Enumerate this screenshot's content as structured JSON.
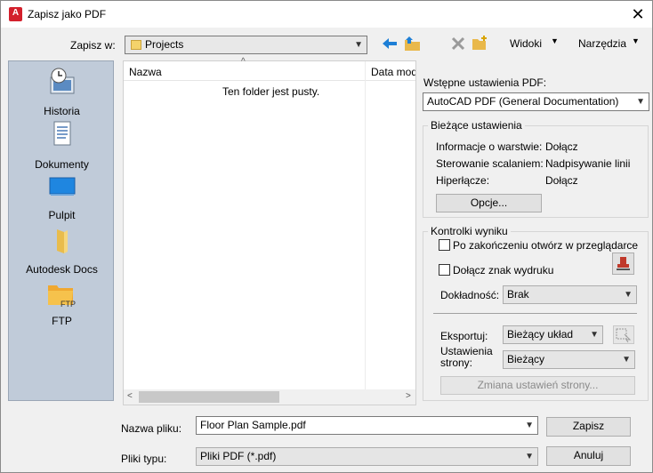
{
  "window": {
    "title": "Zapisz jako PDF",
    "app_icon": "A"
  },
  "toolbar": {
    "save_in_label": "Zapisz w:",
    "save_in_value": "Projects",
    "views_label": "Widoki",
    "tools_label": "Narzędzia"
  },
  "places": [
    {
      "label": "Historia",
      "icon": "history-icon"
    },
    {
      "label": "Dokumenty",
      "icon": "documents-icon"
    },
    {
      "label": "Pulpit",
      "icon": "desktop-icon"
    },
    {
      "label": "Autodesk Docs",
      "icon": "folder-icon"
    },
    {
      "label": "FTP",
      "icon": "ftp-folder-icon"
    }
  ],
  "filelist": {
    "col_name": "Nazwa",
    "col_date": "Data mod",
    "empty_text": "Ten folder jest pusty."
  },
  "pdf": {
    "presets_label": "Wstępne ustawienia PDF:",
    "preset_value": "AutoCAD PDF (General Documentation)",
    "current_title": "Bieżące ustawienia",
    "layers_label": "Informacje o warstwie:",
    "layers_value": "Dołącz",
    "merge_label": "Sterowanie scalaniem:",
    "merge_value": "Nadpisywanie linii",
    "hyperlinks_label": "Hiperłącze:",
    "hyperlinks_value": "Dołącz",
    "options_button": "Opcje...",
    "output_title": "Kontrolki wyniku",
    "open_after_label": "Po zakończeniu otwórz w przeglądarce",
    "plot_stamp_label": "Dołącz znak wydruku",
    "precision_label": "Dokładność:",
    "precision_value": "Brak",
    "export_label": "Eksportuj:",
    "export_value": "Bieżący układ",
    "page_setup_label": "Ustawienia strony:",
    "page_setup_value": "Bieżący",
    "page_setup_button": "Zmiana ustawień strony..."
  },
  "footer": {
    "filename_label": "Nazwa pliku:",
    "filename_value": "Floor Plan Sample.pdf",
    "filetype_label": "Pliki typu:",
    "filetype_value": "Pliki PDF (*.pdf)",
    "save_button": "Zapisz",
    "cancel_button": "Anuluj"
  }
}
